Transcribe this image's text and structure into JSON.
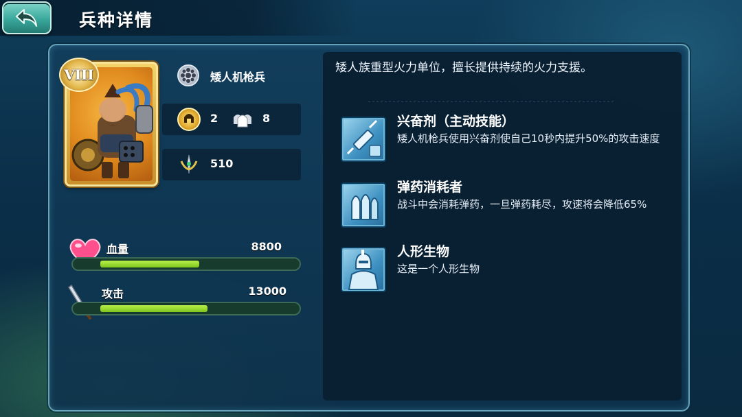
{
  "header": {
    "title": "兵种详情"
  },
  "unit": {
    "rank": "VIII",
    "name": "矮人机枪兵",
    "cost": "2",
    "capacity": "8",
    "power": "510"
  },
  "stats": {
    "hp": {
      "label": "血量",
      "value": "8800",
      "fill_fraction": 0.5
    },
    "attack": {
      "label": "攻击",
      "value": "13000",
      "fill_fraction": 0.54
    }
  },
  "description": {
    "lead": "矮人族重型火力单位，擅长提供持续的火力支援。",
    "skills": [
      {
        "title": "兴奋剂（主动技能）",
        "text": "矮人机枪兵使用兴奋剂使自己10秒内提升50%的攻击速度",
        "icon": "syringe-icon"
      },
      {
        "title": "弹药消耗者",
        "text": "战斗中会消耗弹药，一旦弹药耗尽，攻速将会降低65%",
        "icon": "bullets-icon"
      },
      {
        "title": "人形生物",
        "text": "这是一个人形生物",
        "icon": "humanoid-icon"
      }
    ]
  },
  "colors": {
    "accent": "#7ec71e",
    "panel_border": "#8cd2e6",
    "gold": "#e3b64a"
  }
}
